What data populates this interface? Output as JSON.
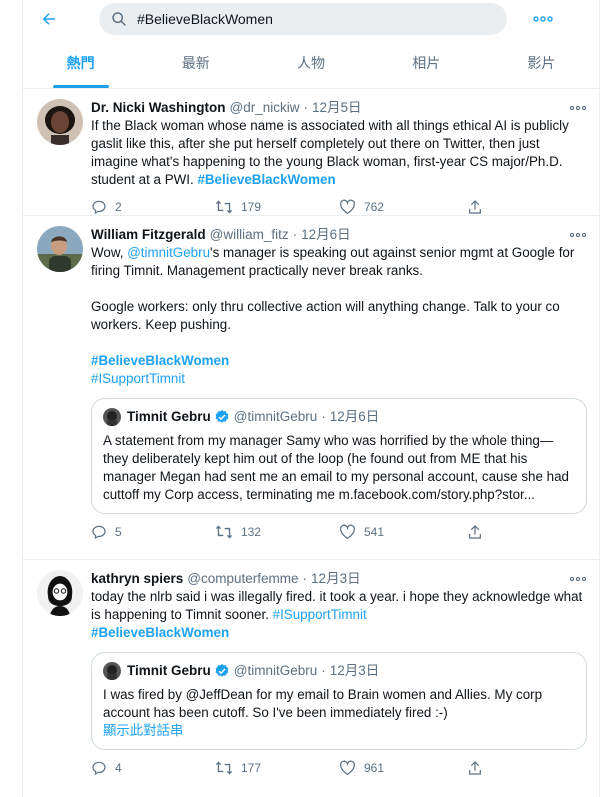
{
  "search": {
    "query": "#BelieveBlackWomen"
  },
  "tabs": [
    {
      "label": "熱門"
    },
    {
      "label": "最新"
    },
    {
      "label": "人物"
    },
    {
      "label": "相片"
    },
    {
      "label": "影片"
    }
  ],
  "colors": {
    "accent": "#1da1f2",
    "secondary_text": "#5b7083",
    "border": "#ebeef0"
  },
  "tweets": [
    {
      "name": "Dr. Nicki Washington",
      "handle": "@dr_nickiw",
      "dot": "·",
      "date": "12月5日",
      "text_part1": "If the Black woman whose name is associated with all things ethical AI is publicly gaslit like this, after she put herself completely out there on Twitter, then just imagine what's happening to the young Black woman, first-year CS major/Ph.D. student at a PWI. ",
      "hashtag": "#BelieveBlackWomen",
      "replies": "2",
      "retweets": "179",
      "likes": "762"
    },
    {
      "name": "William Fitzgerald",
      "handle": "@william_fitz",
      "dot": "·",
      "date": "12月6日",
      "text_prefix": "Wow, ",
      "mention": "@timnitGebru",
      "text_part1": "'s manager is speaking out against senior mgmt at Google for firing Timnit. Management practically never break ranks.",
      "text_part2": "Google workers: only thru collective action will anything change. Talk to your co workers. Keep pushing.",
      "hashtag1": "#BelieveBlackWomen",
      "hashtag2": "#ISupportTimnit",
      "quote": {
        "name": "Timnit Gebru",
        "handle": "@timnitGebru",
        "dot": "·",
        "date": "12月6日",
        "text": "A statement from my manager Samy who was horrified by the whole thing—they deliberately kept him out of the loop (he found out from ME that his manager Megan had sent me an email to my personal account, cause she had cuttoff my Corp access, terminating me m.facebook.com/story.php?stor..."
      },
      "replies": "5",
      "retweets": "132",
      "likes": "541"
    },
    {
      "name": "kathryn spiers",
      "handle": "@computerfemme",
      "dot": "·",
      "date": "12月3日",
      "text_part1": "today the nlrb said i was illegally fired. it took a year. i hope they acknowledge what is happening to Timnit sooner. ",
      "hashtag1": "#ISupportTimnit",
      "hashtag2": "#BelieveBlackWomen",
      "quote": {
        "name": "Timnit Gebru",
        "handle": "@timnitGebru",
        "dot": "·",
        "date": "12月3日",
        "text": "I was fired by @JeffDean for my email to Brain women and Allies. My corp account has been cutoff. So I've been immediately fired :-)",
        "show_thread": "顯示此對話串"
      },
      "replies": "4",
      "retweets": "177",
      "likes": "961"
    }
  ]
}
